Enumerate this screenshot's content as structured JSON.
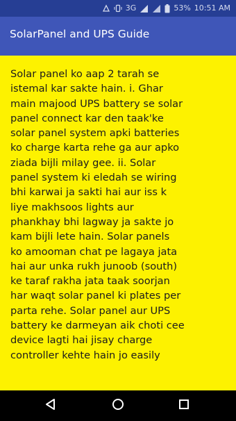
{
  "status_bar": {
    "network_label": "3G",
    "battery_percent": "53%",
    "time": "10:51 AM"
  },
  "app_bar": {
    "title": "SolarPanel and UPS Guide"
  },
  "article": {
    "text": "Solar panel ko aap 2 tarah se\nistemal kar sakte hain.  i. Ghar\nmain majood UPS battery se solar\npanel connect kar den taak'ke\nsolar panel system apki batteries\nko charge karta rehe ga aur apko\nziada bijli milay gee.  ii. Solar\npanel system ki eledah se wiring\nbhi karwai ja sakti hai aur iss k\nliye makhsoos lights aur\nphankhay bhi lagway ja sakte jo\nkam bijli lete hain.  Solar panels\nko amooman chat pe lagaya jata\nhai aur unka rukh junoob (south)\nke taraf rakha jata taak soorjan\nhar waqt solar panel ki plates per\nparta rehe. Solar panel aur UPS\nbattery ke darmeyan aik choti cee\ndevice lagti hai jisay charge\ncontroller kehte hain jo easily"
  },
  "colors": {
    "status_bar": "#263e94",
    "app_bar": "#3f56b8",
    "content_background": "#fdf200",
    "nav_bar": "#000000"
  },
  "nav_bar": {
    "back_icon": "back-triangle-icon",
    "home_icon": "home-circle-icon",
    "recents_icon": "recents-square-icon"
  }
}
